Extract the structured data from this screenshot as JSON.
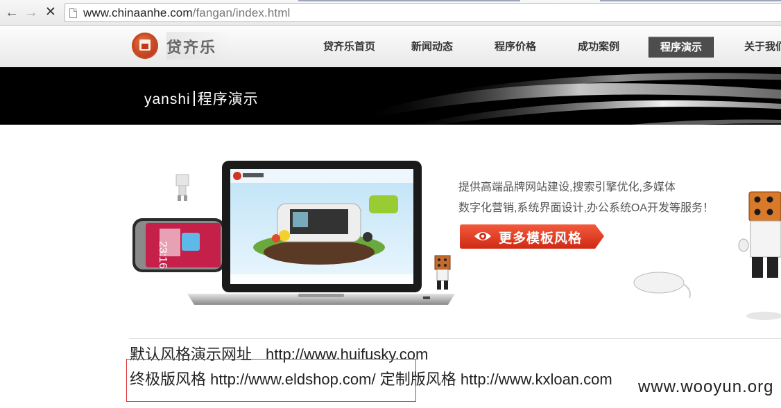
{
  "browser": {
    "url_host": "www.chinaanhe.com",
    "url_path": "/fangan/index.html"
  },
  "site": {
    "logo_text": "贷齐乐",
    "nav": [
      {
        "label": "贷齐乐首页"
      },
      {
        "label": "新闻动态"
      },
      {
        "label": "程序价格"
      },
      {
        "label": "成功案例"
      },
      {
        "label": "程序演示",
        "active": true
      },
      {
        "label": "关于我们"
      }
    ]
  },
  "banner": {
    "title_en": "yanshi",
    "title_cn": "程序演示"
  },
  "promo": {
    "line1": "提供高端品牌网站建设,搜索引擎优化,多媒体",
    "line2": "数字化营销,系统界面设计,办公系统OA开发等服务！",
    "button_label": "更多模板风格",
    "button_color": "#e0321c"
  },
  "info": {
    "line1_label": "默认风格演示网址",
    "line1_url": "http://www.huifusky.com",
    "line2_label_a": "终极版风格",
    "line2_url_a": "http://www.eldshop.com/",
    "line2_label_b": "定制版风格",
    "line2_url_b": "http://www.kxloan.com"
  },
  "watermark": "www.wooyun.org"
}
